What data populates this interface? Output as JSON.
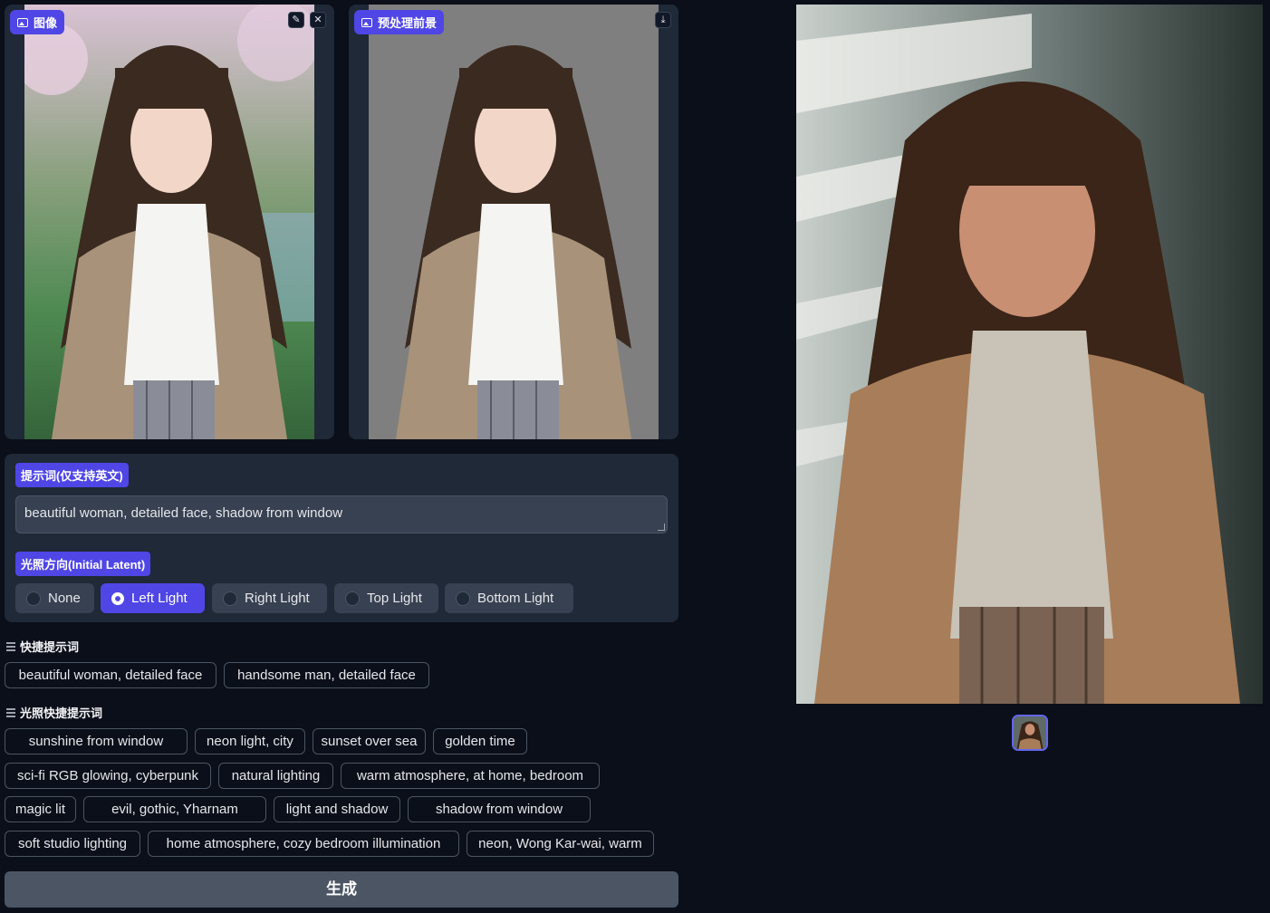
{
  "input_panel": {
    "label": "图像",
    "edit_icon": "pencil-icon",
    "close_icon": "close-icon"
  },
  "preprocessed_panel": {
    "label": "预处理前景",
    "download_icon": "download-icon"
  },
  "prompt": {
    "label": "提示词(仅支持英文)",
    "value": "beautiful woman, detailed face, shadow from window"
  },
  "lighting_direction": {
    "label": "光照方向(Initial Latent)",
    "options": [
      "None",
      "Left Light",
      "Right Light",
      "Top Light",
      "Bottom Light"
    ],
    "selected": "Left Light"
  },
  "quick_prompts": {
    "title": "快捷提示词",
    "items": [
      "beautiful woman, detailed face",
      "handsome man, detailed face"
    ]
  },
  "lighting_quick_prompts": {
    "title": "光照快捷提示词",
    "items": [
      "sunshine from window",
      "neon light, city",
      "sunset over sea",
      "golden time",
      "sci-fi RGB glowing, cyberpunk",
      "natural lighting",
      "warm atmosphere, at home, bedroom",
      "magic lit",
      "evil, gothic, Yharnam",
      "light and shadow",
      "shadow from window",
      "soft studio lighting",
      "home atmosphere, cozy bedroom illumination",
      "neon, Wong Kar-wai, warm"
    ]
  },
  "generate_button": "生成",
  "colors": {
    "accent": "#4f46e5",
    "panel": "#1f2937",
    "background": "#0b0f19"
  }
}
